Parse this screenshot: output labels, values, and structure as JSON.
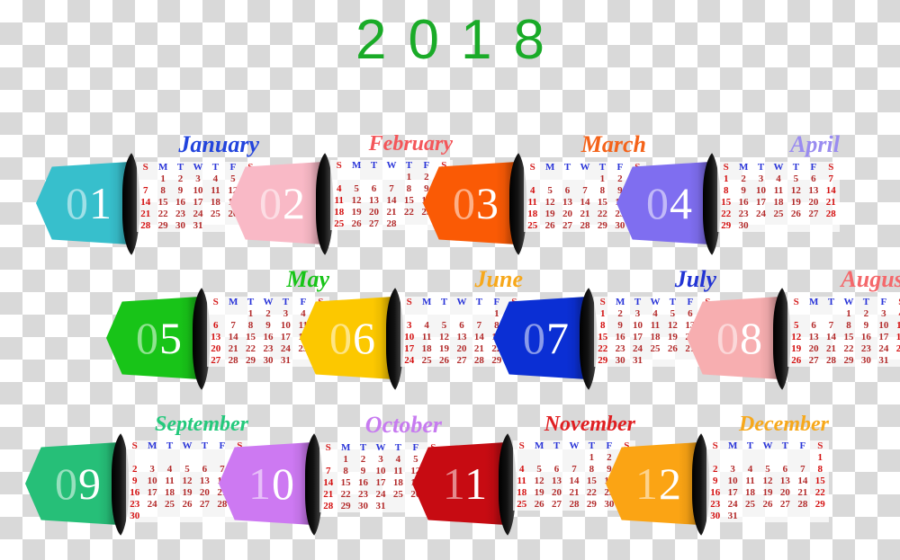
{
  "year": "2018",
  "accent_year_color": "#1aab28",
  "weekday_headers": [
    "S",
    "M",
    "T",
    "W",
    "T",
    "F",
    "S"
  ],
  "months": [
    {
      "number": "01",
      "name": "January",
      "badge_color": "#37bfcc",
      "name_color": "#2244dd",
      "first_weekday_index": 1,
      "days_in_month": 31,
      "row": 0,
      "col": 0
    },
    {
      "number": "02",
      "name": "February",
      "badge_color": "#f9b9c6",
      "name_color": "#f4565a",
      "first_weekday_index": 4,
      "days_in_month": 28,
      "row": 0,
      "col": 1
    },
    {
      "number": "03",
      "name": "March",
      "badge_color": "#fa5a05",
      "name_color": "#f4631a",
      "first_weekday_index": 4,
      "days_in_month": 31,
      "row": 0,
      "col": 2
    },
    {
      "number": "04",
      "name": "April",
      "badge_color": "#7f6ef0",
      "name_color": "#9a8cf0",
      "first_weekday_index": 0,
      "days_in_month": 30,
      "row": 0,
      "col": 3
    },
    {
      "number": "05",
      "name": "May",
      "badge_color": "#18c418",
      "name_color": "#18c418",
      "first_weekday_index": 2,
      "days_in_month": 31,
      "row": 1,
      "col": 0
    },
    {
      "number": "06",
      "name": "June",
      "badge_color": "#fcc800",
      "name_color": "#f7a81b",
      "first_weekday_index": 5,
      "days_in_month": 30,
      "row": 1,
      "col": 1
    },
    {
      "number": "07",
      "name": "July",
      "badge_color": "#0b2fd4",
      "name_color": "#2234d4",
      "first_weekday_index": 0,
      "days_in_month": 31,
      "row": 1,
      "col": 2
    },
    {
      "number": "08",
      "name": "August",
      "badge_color": "#f7aeb0",
      "name_color": "#f4686b",
      "first_weekday_index": 3,
      "days_in_month": 31,
      "row": 1,
      "col": 3
    },
    {
      "number": "09",
      "name": "September",
      "badge_color": "#26bf78",
      "name_color": "#24c97c",
      "first_weekday_index": 6,
      "days_in_month": 30,
      "row": 2,
      "col": 0
    },
    {
      "number": "10",
      "name": "October",
      "badge_color": "#cd79f2",
      "name_color": "#c77bf0",
      "first_weekday_index": 1,
      "days_in_month": 31,
      "row": 2,
      "col": 1
    },
    {
      "number": "11",
      "name": "November",
      "badge_color": "#c70b12",
      "name_color": "#e01f22",
      "first_weekday_index": 4,
      "days_in_month": 30,
      "row": 2,
      "col": 2
    },
    {
      "number": "12",
      "name": "December",
      "badge_color": "#fba414",
      "name_color": "#f7a81b",
      "first_weekday_index": 6,
      "days_in_month": 31,
      "row": 2,
      "col": 3
    }
  ],
  "layout": {
    "row_tops": [
      150,
      300,
      462
    ],
    "row_lefts": [
      40,
      118,
      28
    ],
    "col_step": 215
  }
}
